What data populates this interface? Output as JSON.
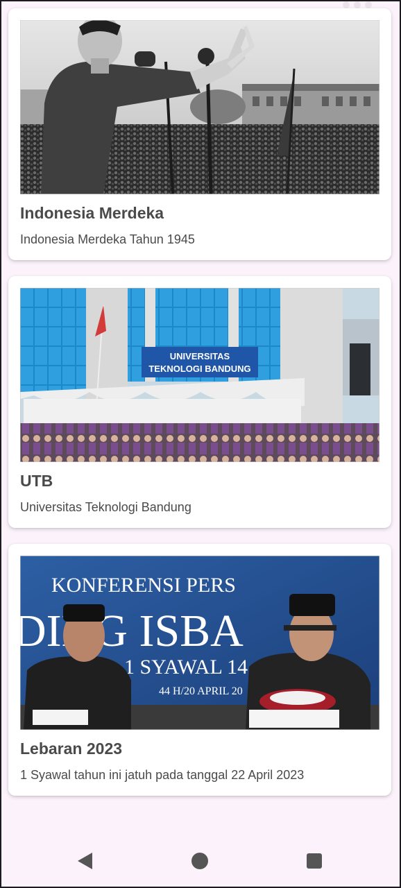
{
  "status_bar": {
    "left_text": "",
    "right_icons": [
      "signal-icon",
      "wifi-icon",
      "battery-icon"
    ]
  },
  "cards": [
    {
      "title": "Indonesia Merdeka",
      "description": "Indonesia Merdeka Tahun 1945",
      "image_icon": "photo-speech-crowd"
    },
    {
      "title": "UTB",
      "description": "Universitas Teknologi Bandung",
      "image_icon": "photo-university-building",
      "image_sign_text": "UNIVERSITAS TEKNOLOGI BANDUNG"
    },
    {
      "title": "Lebaran 2023",
      "description": "1 Syawal tahun ini jatuh pada tanggal 22 April 2023",
      "image_icon": "photo-press-conference",
      "image_banner_lines": [
        "KONFERENSI PERS",
        "DING ISBA",
        "1 SYAWAL 14",
        "44 H/20 APRIL 20"
      ]
    }
  ],
  "navbar": {
    "back_icon": "back-icon",
    "home_icon": "home-icon",
    "recents_icon": "recents-icon"
  },
  "colors": {
    "background": "#fcf2fb",
    "card": "#ffffff",
    "text": "#4a4a4a",
    "nav_icon": "#555555"
  }
}
